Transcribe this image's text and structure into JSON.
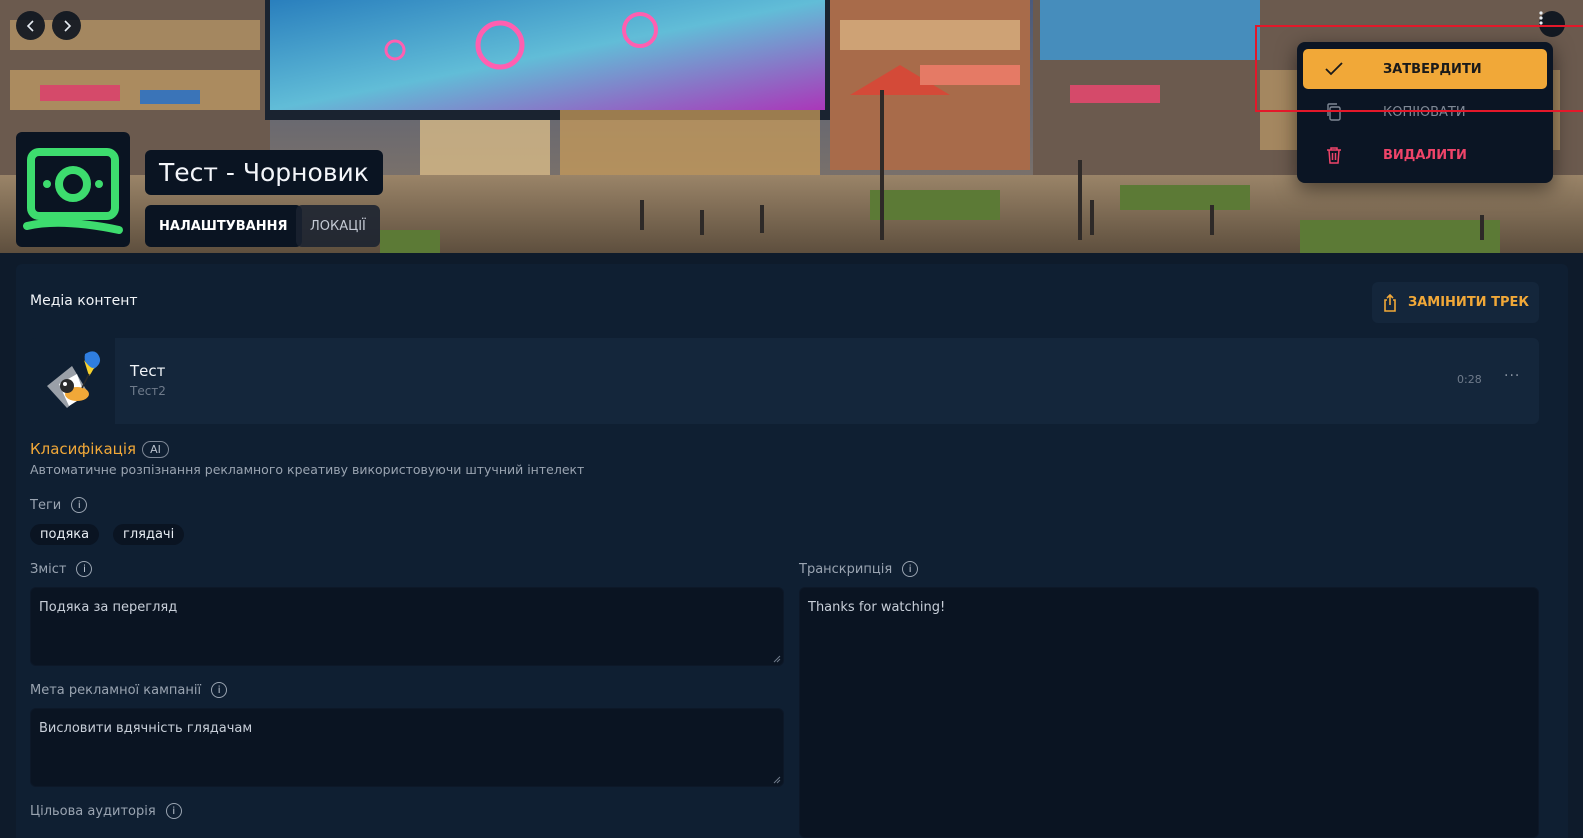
{
  "header": {
    "title": "Тест - Чорновик",
    "tabs": [
      {
        "label": "НАЛАШТУВАННЯ",
        "active": true
      },
      {
        "label": "ЛОКАЦІЇ",
        "active": false
      }
    ],
    "nav": {
      "back_icon": "chevron-left-icon",
      "forward_icon": "chevron-right-icon",
      "more_icon": "kebab-menu-icon"
    }
  },
  "menu": {
    "items": [
      {
        "label": "ЗАТВЕРДИТИ",
        "icon": "check-icon",
        "color": "#f1a838"
      },
      {
        "label": "КОПІЮВАТИ",
        "icon": "copy-icon"
      },
      {
        "label": "ВИДАЛИТИ",
        "icon": "trash-icon",
        "color": "#ef4469"
      }
    ]
  },
  "media": {
    "section_title": "Медіа контент",
    "replace_button": "ЗАМІНИТИ ТРЕК",
    "track": {
      "name": "Тест",
      "subtitle": "Тест2",
      "duration": "0:28",
      "more": "···"
    }
  },
  "classification": {
    "title": "Класифікація",
    "badge": "AI",
    "description": "Автоматичне розпізнання рекламного креативу використовуючи штучний інтелект"
  },
  "fields": {
    "tags_label": "Теги",
    "tags": [
      "подяка",
      "глядачі"
    ],
    "content_label": "Зміст",
    "content_value": "Подяка за перегляд",
    "transcription_label": "Транскрипція",
    "transcription_value": "Thanks for watching!",
    "campaign_goal_label": "Мета рекламної кампанії",
    "campaign_goal_value": "Висловити вдячність глядачам",
    "target_audience_label": "Цільова аудиторія",
    "info_glyph": "i"
  },
  "colors": {
    "accent": "#f1a838",
    "danger": "#ef4469",
    "logo_green": "#3ddc6e",
    "background": "#0e1b2b",
    "highlight": "#e3182a"
  }
}
